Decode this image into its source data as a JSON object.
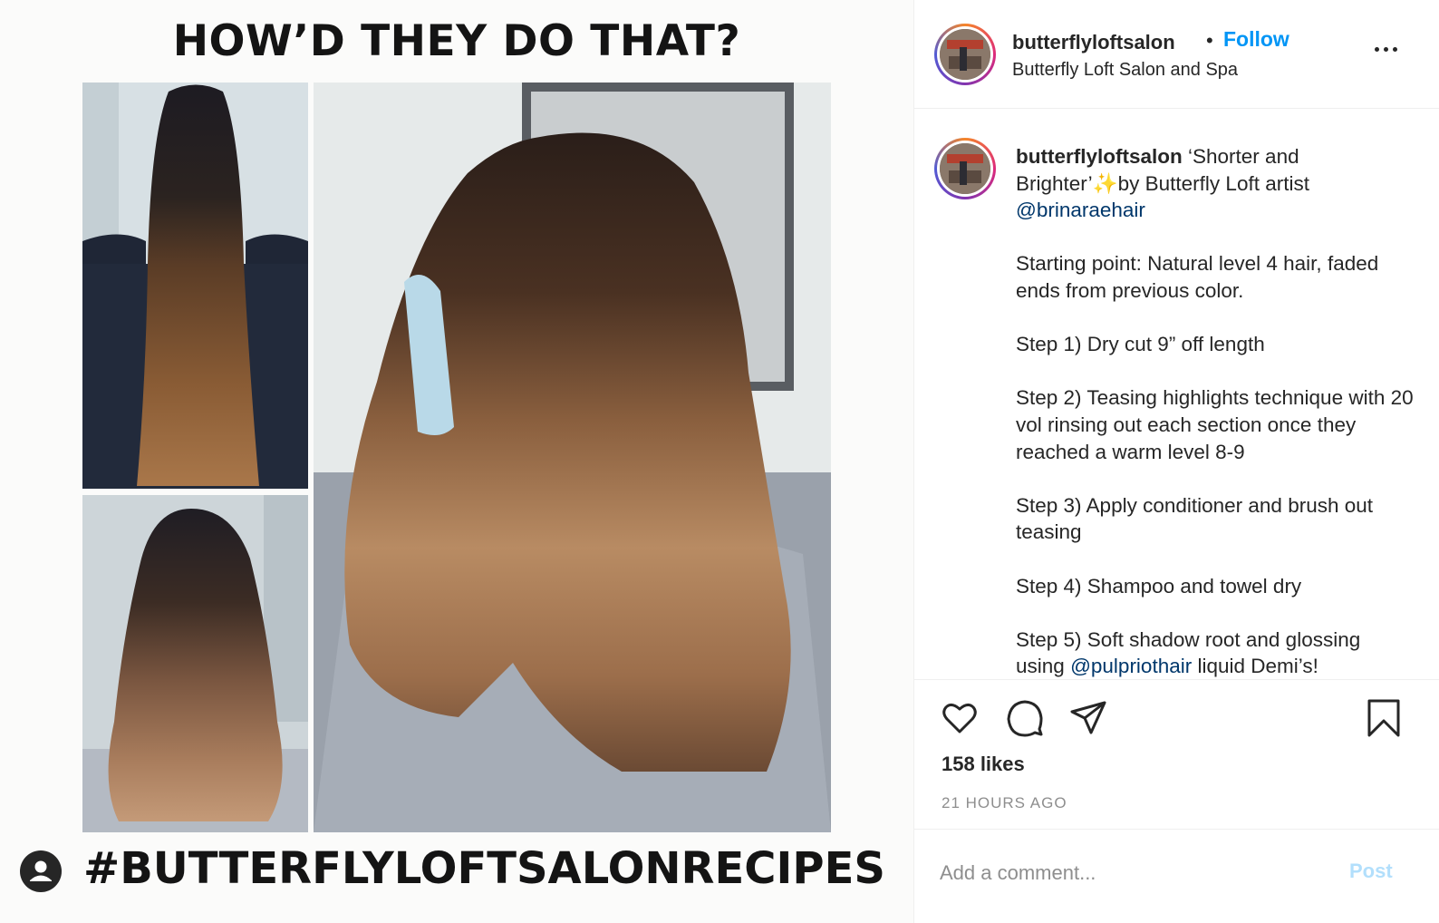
{
  "media": {
    "headline": "HOW’D THEY DO THAT?",
    "hashtag": "#BUTTERFLYLOFTSALONRECIPES",
    "images": {
      "before": "before-hair-photo",
      "after_back": "after-hair-back-photo",
      "after_main": "after-hair-side-photo"
    }
  },
  "post": {
    "username": "butterflyloftsalon",
    "separator": "•",
    "follow_label": "Follow",
    "location": "Butterfly Loft Salon and Spa",
    "caption": {
      "username": "butterflyloftsalon",
      "intro": "‘Shorter and Brighter’✨by Butterfly Loft artist",
      "mention": "@brinaraehair",
      "start": "Starting point: Natural level 4 hair, faded ends from previous color.",
      "step1": "Step 1) Dry cut 9” off length",
      "step2": "Step 2) Teasing highlights technique with 20 vol rinsing out each section once they reached a warm level 8-9",
      "step3": "Step 3) Apply conditioner and brush out teasing",
      "step4": "Step 4) Shampoo and towel dry",
      "step5_pre": "Step 5) Soft shadow root and glossing using",
      "step5_mention": "@pulpriothair",
      "step5_post": "liquid Demi’s!"
    },
    "likes": "158 likes",
    "timestamp": "21 HOURS AGO",
    "comment_placeholder": "Add a comment...",
    "post_label": "Post"
  },
  "colors": {
    "accent": "#0095f6",
    "post_disabled": "#b2dffc",
    "text": "#262626",
    "muted": "#8e8e8e",
    "mention": "#00376b"
  },
  "icons": [
    "heart-icon",
    "comment-icon",
    "share-icon",
    "bookmark-icon",
    "more-icon",
    "account-icon"
  ]
}
